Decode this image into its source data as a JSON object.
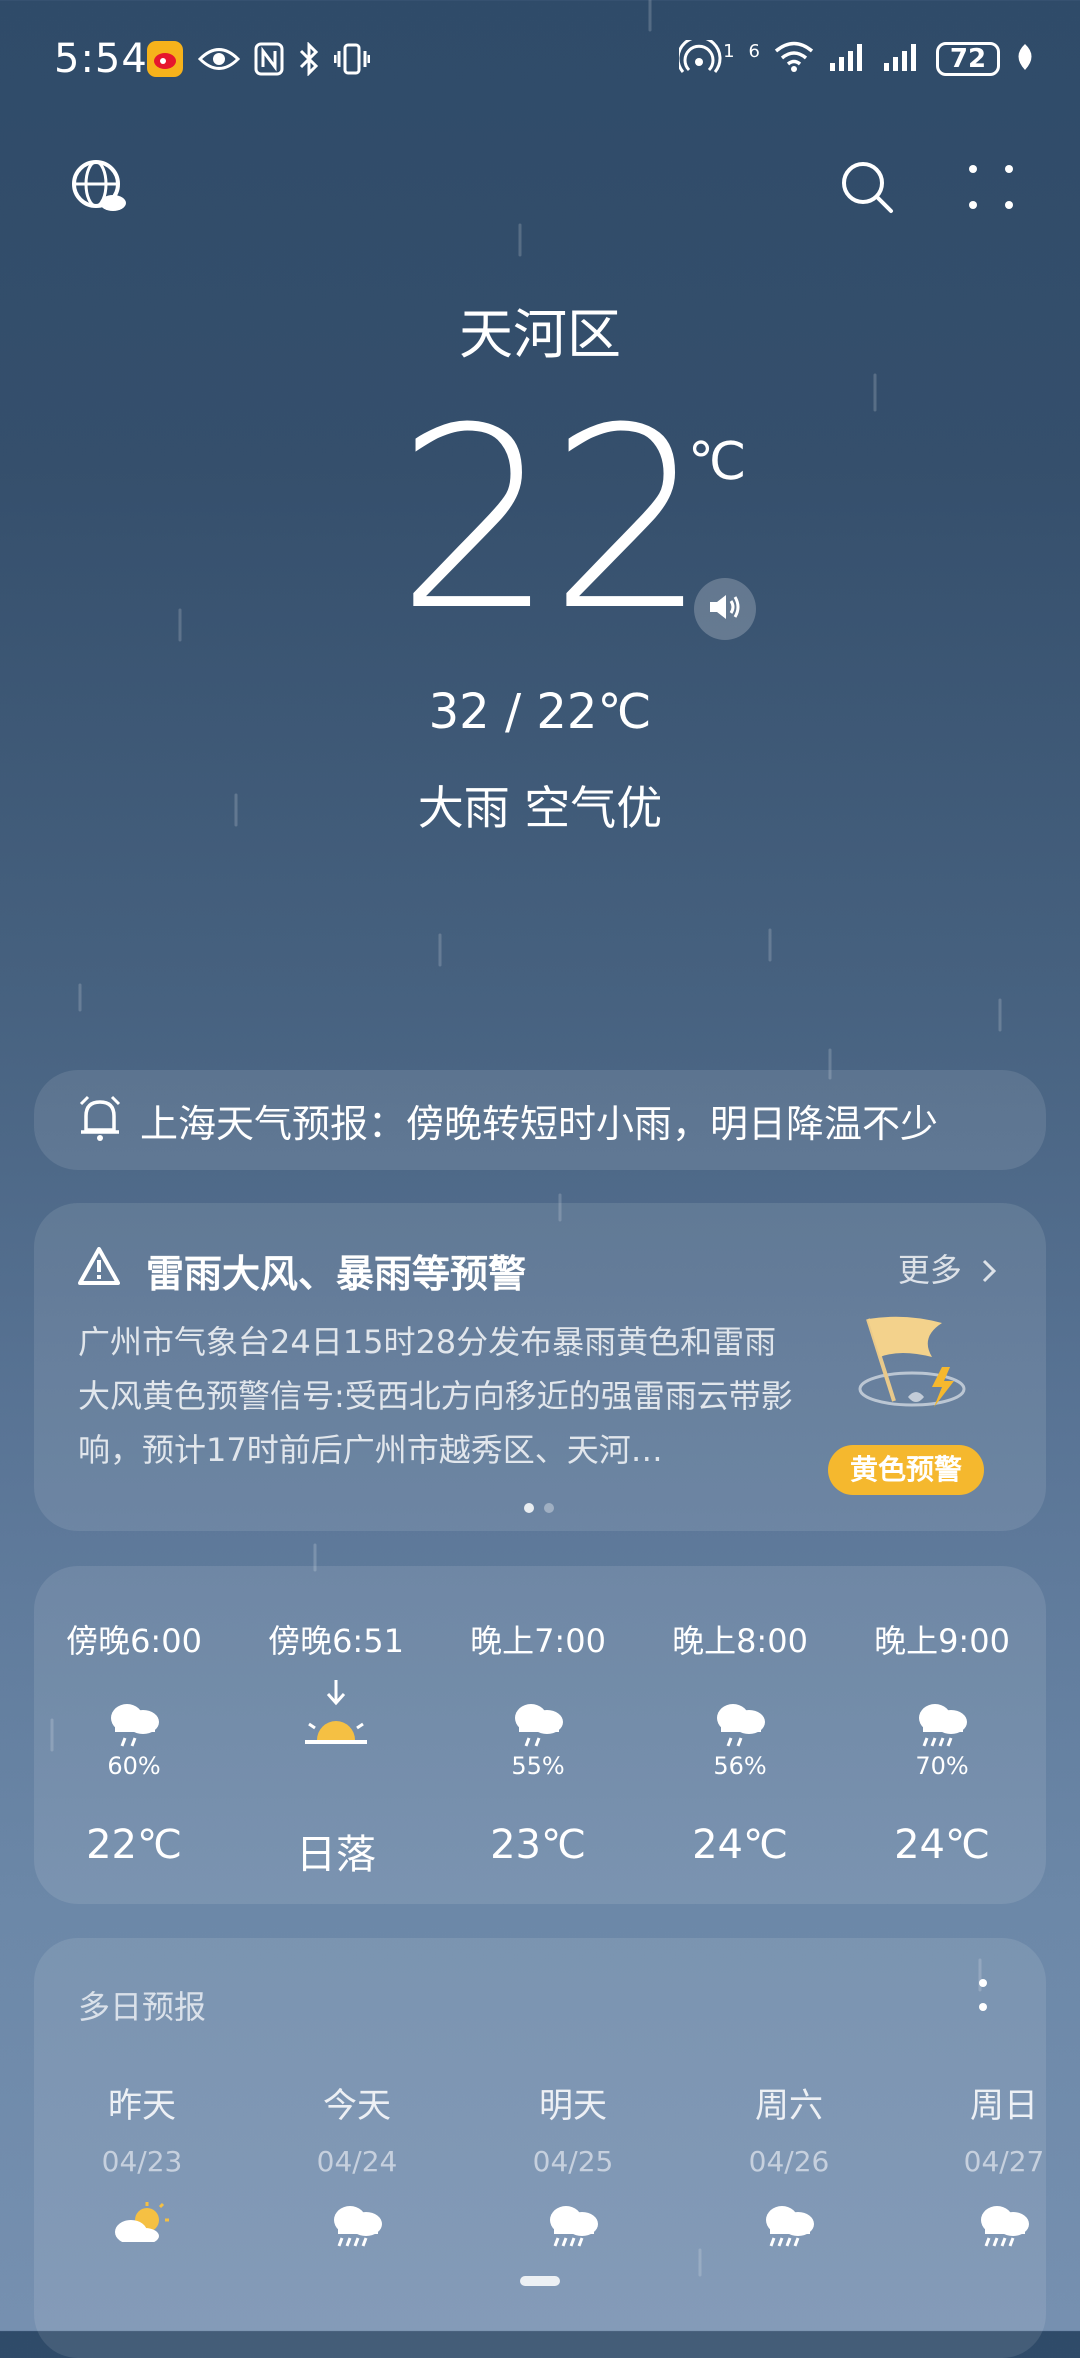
{
  "status_bar": {
    "time": "5:54",
    "network_label_1": "1",
    "network_label_2": "6",
    "battery": "72"
  },
  "header": {
    "location": "天河区",
    "temperature": "22",
    "unit": "℃",
    "range": "32 / 22℃",
    "condition": "大雨  空气优"
  },
  "notice": {
    "text": "上海天气预报：傍晚转短时小雨，明日降温不少"
  },
  "warning": {
    "title": "雷雨大风、暴雨等预警",
    "more": "更多",
    "body": "广州市气象台24日15时28分发布暴雨黄色和雷雨大风黄色预警信号:受西北方向移近的强雷雨云带影响，预计17时前后广州市越秀区、天河…",
    "badge": "黄色预警"
  },
  "hourly": [
    {
      "time": "傍晚6:00",
      "icon": "rain-cloud-icon",
      "precip": "60%",
      "value": "22℃"
    },
    {
      "time": "傍晚6:51",
      "icon": "sunset-icon",
      "precip": "",
      "value": "日落"
    },
    {
      "time": "晚上7:00",
      "icon": "rain-cloud-icon",
      "precip": "55%",
      "value": "23℃"
    },
    {
      "time": "晚上8:00",
      "icon": "rain-cloud-icon",
      "precip": "56%",
      "value": "24℃"
    },
    {
      "time": "晚上9:00",
      "icon": "heavy-rain-cloud-icon",
      "precip": "70%",
      "value": "24℃"
    }
  ],
  "multi_day": {
    "title": "多日预报",
    "days": [
      {
        "day": "昨天",
        "date": "04/23",
        "icon": "partly-cloudy-icon"
      },
      {
        "day": "今天",
        "date": "04/24",
        "icon": "heavy-rain-cloud-icon"
      },
      {
        "day": "明天",
        "date": "04/25",
        "icon": "heavy-rain-cloud-icon"
      },
      {
        "day": "周六",
        "date": "04/26",
        "icon": "heavy-rain-cloud-icon"
      },
      {
        "day": "周日",
        "date": "04/27",
        "icon": "heavy-rain-cloud-icon"
      }
    ]
  },
  "colors": {
    "background_top": "#2f4b69",
    "background_bottom": "#7690b0",
    "warning_badge": "#f5b82e"
  }
}
